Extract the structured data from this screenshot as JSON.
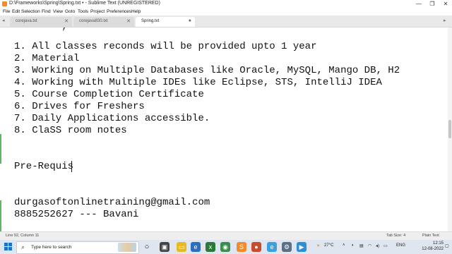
{
  "window": {
    "title": "D:\\Frameworks\\Spring\\Spring.txt • - Sublime Text (UNREGISTERED)",
    "controls": {
      "minimize": "—",
      "maximize": "❐",
      "close": "✕"
    }
  },
  "menu": [
    "File",
    "Edit",
    "Selection",
    "Find",
    "View",
    "Goto",
    "Tools",
    "Project",
    "Preferences",
    "Help"
  ],
  "tabs": {
    "left_arrow": "◂",
    "right_arrow": "▸",
    "items": [
      {
        "label": "corejava.txt",
        "close": "✕",
        "active": false
      },
      {
        "label": "corejava830.txt",
        "close": "✕",
        "active": false
      },
      {
        "label": "Spring.txt",
        "close": "●",
        "active": true
      }
    ]
  },
  "editor": {
    "partial_top_line": "    -   ,      -",
    "lines": [
      "1. All classes reconds will be provided upto 1 year",
      "2. Material",
      "3. Working on Multiple Databases like Oracle, MySQL, Mango DB, H2",
      "4. Working with Multiple IDEs like Eclipse, STS, IntelliJ IDEA",
      "5. Course Completion Certificate",
      "6. Drives for Freshers",
      "7. Daily Applications accessible.",
      "8. ClaSS room notes"
    ],
    "current_line": "Pre-Requis",
    "contact_email": "durgasoftonlinetraining@gmail.com",
    "contact_phone": "8885252627 --- Bavani"
  },
  "status": {
    "position": "Line 92, Column 11",
    "tab_size": "Tab Size: 4",
    "syntax": "Plain Text"
  },
  "taskbar": {
    "search_placeholder": "Type here to search",
    "weather": "27°C",
    "language": "ENG",
    "time": "12:15",
    "date": "12-08-2022",
    "accent": "#1a73c8"
  }
}
